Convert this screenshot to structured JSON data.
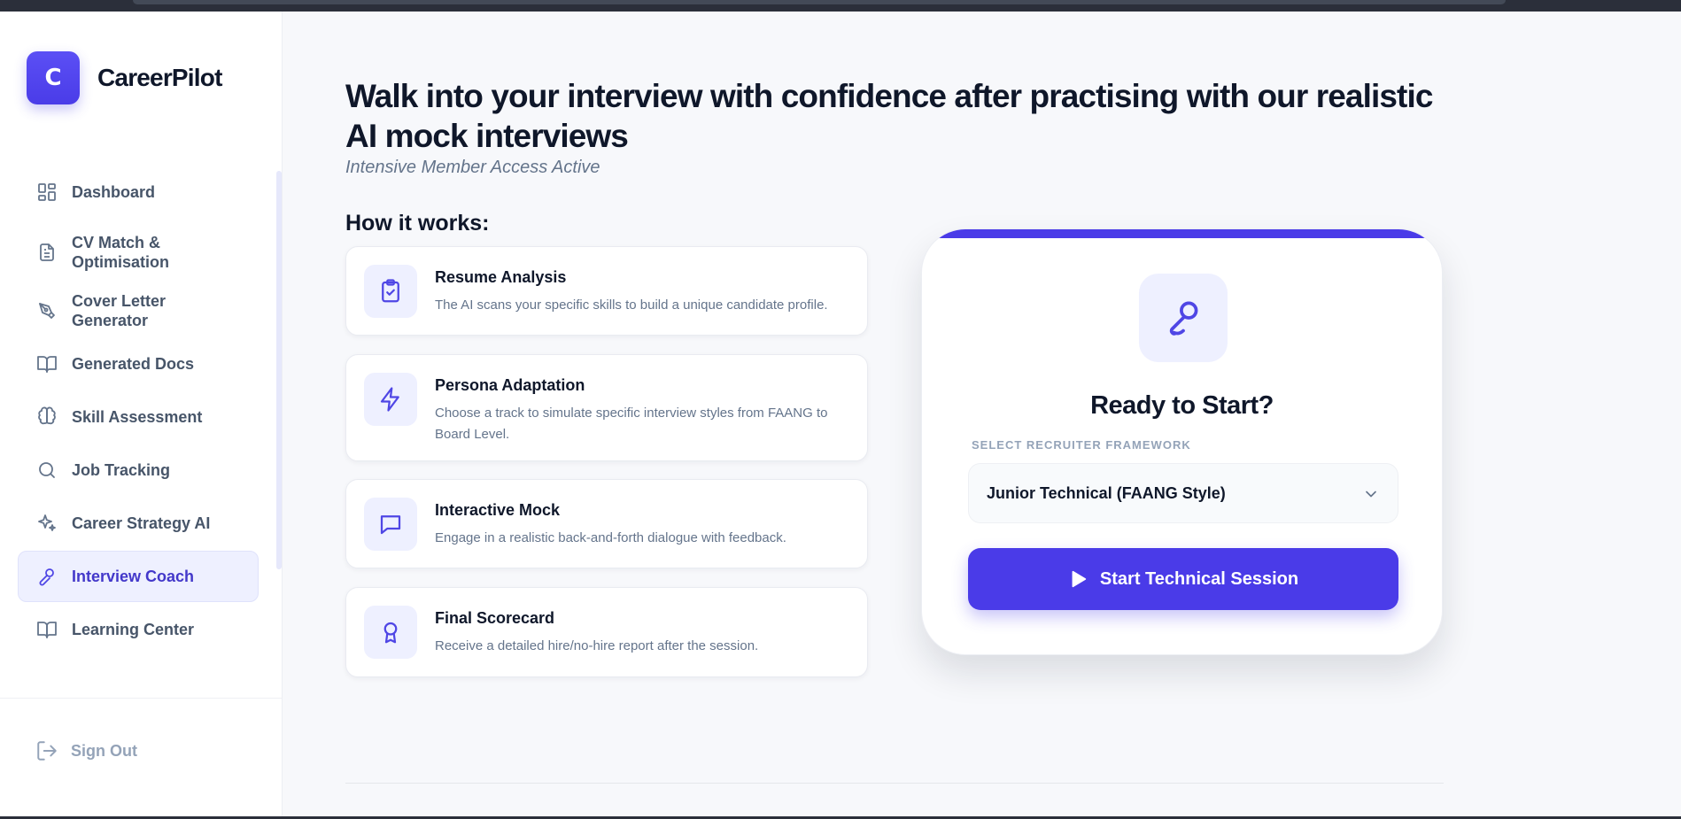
{
  "app": {
    "name": "CareerPilot",
    "logo_letter": "C"
  },
  "sidebar": {
    "items": [
      {
        "label": "Dashboard",
        "icon": "dashboard-grid-icon",
        "active": false
      },
      {
        "label": "CV Match & Optimisation",
        "icon": "document-icon",
        "active": false
      },
      {
        "label": "Cover Letter Generator",
        "icon": "pen-nib-icon",
        "active": false
      },
      {
        "label": "Generated Docs",
        "icon": "book-open-icon",
        "active": false
      },
      {
        "label": "Skill Assessment",
        "icon": "brain-icon",
        "active": false
      },
      {
        "label": "Job Tracking",
        "icon": "search-icon",
        "active": false
      },
      {
        "label": "Career Strategy AI",
        "icon": "sparkles-icon",
        "active": false
      },
      {
        "label": "Interview Coach",
        "icon": "microphone-icon",
        "active": true
      },
      {
        "label": "Learning Center",
        "icon": "book-open-icon",
        "active": false
      }
    ],
    "sign_out": "Sign Out"
  },
  "main": {
    "headline": "Walk into your interview with confidence after practising with our realistic AI mock interviews",
    "subline": "Intensive Member Access Active",
    "how_title": "How it works:",
    "steps": [
      {
        "title": "Resume Analysis",
        "desc": "The AI scans your specific skills to build a unique candidate profile.",
        "icon": "clipboard-check-icon"
      },
      {
        "title": "Persona Adaptation",
        "desc": "Choose a track to simulate specific interview styles from FAANG to Board Level.",
        "icon": "lightning-icon"
      },
      {
        "title": "Interactive Mock",
        "desc": "Engage in a realistic back-and-forth dialogue with feedback.",
        "icon": "chat-bubble-icon"
      },
      {
        "title": "Final Scorecard",
        "desc": "Receive a detailed hire/no-hire report after the session.",
        "icon": "award-ribbon-icon"
      }
    ]
  },
  "start_card": {
    "title": "Ready to Start?",
    "select_label": "SELECT RECRUITER FRAMEWORK",
    "selected_framework": "Junior Technical (FAANG Style)",
    "start_button": "Start Technical Session"
  },
  "colors": {
    "accent": "#4a3be8",
    "accent_light": "#eef0ff",
    "text_dark": "#0f172a",
    "text_muted": "#64748b"
  }
}
